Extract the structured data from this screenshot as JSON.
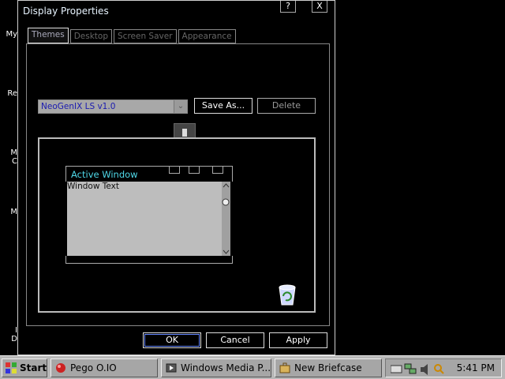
{
  "desktop": {
    "icon_labels": [
      "My",
      "Re",
      "M\nC",
      "M",
      "I\nD"
    ]
  },
  "dialog": {
    "title": "Display Properties",
    "title_controls": [
      "?",
      "X"
    ],
    "tabs": [
      {
        "label": "Themes",
        "active": true
      },
      {
        "label": "Desktop",
        "active": false
      },
      {
        "label": "Screen Saver",
        "active": false
      },
      {
        "label": "Appearance",
        "active": false
      }
    ],
    "theme_select": {
      "value": "NeoGenIX LS v1.0"
    },
    "save_as_label": "Save As...",
    "delete_label": "Delete",
    "preview": {
      "window_title": "Active Window",
      "window_text": "Window Text"
    },
    "ok_label": "OK",
    "cancel_label": "Cancel",
    "apply_label": "Apply"
  },
  "taskbar": {
    "start_label": "Start",
    "items": [
      {
        "label": "Pego O.IO",
        "icon": "app-icon"
      },
      {
        "label": "Windows Media P...",
        "icon": "media-player-icon"
      },
      {
        "label": "New Briefcase",
        "icon": "briefcase-icon"
      }
    ],
    "clock": "5:41 PM"
  },
  "colors": {
    "accent_cyan": "#4fd8e8",
    "taskbar": "#b8b8b8",
    "combo_text": "#1a1ab0"
  }
}
